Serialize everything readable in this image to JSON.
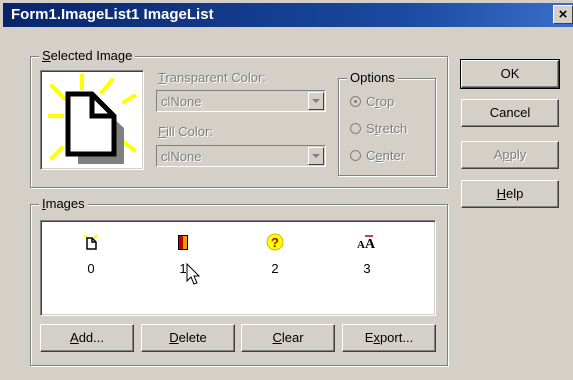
{
  "window": {
    "title": "Form1.ImageList1 ImageList",
    "close_glyph": "×"
  },
  "selected_image": {
    "group_label_pre": "",
    "group_label_u": "S",
    "group_label_post": "elected Image",
    "transparent_color": {
      "label_u": "T",
      "label_post": "ransparent Color:",
      "value": "clNone"
    },
    "fill_color": {
      "label_u": "F",
      "label_post": "ill Color:",
      "value": "clNone"
    },
    "options": {
      "label": "Options",
      "crop": {
        "u": "r",
        "pre": "C",
        "post": "op",
        "selected": true
      },
      "stretch": {
        "pre": "S",
        "u": "t",
        "post": "retch"
      },
      "center": {
        "pre": "C",
        "u": "e",
        "post": "nter"
      }
    }
  },
  "images": {
    "group_label_u": "I",
    "group_label_post": "mages",
    "items": [
      {
        "caption": "0",
        "icon": "new-document-icon"
      },
      {
        "caption": "1",
        "icon": "door-icon"
      },
      {
        "caption": "2",
        "icon": "help-icon"
      },
      {
        "caption": "3",
        "icon": "font-icon"
      }
    ]
  },
  "buttons": {
    "ok": "OK",
    "cancel": "Cancel",
    "apply_pre": "A",
    "apply_u": "p",
    "apply_post": "ply",
    "help_u": "H",
    "help_post": "elp",
    "add_u": "A",
    "add_post": "dd...",
    "delete_u": "D",
    "delete_post": "elete",
    "clear_u": "C",
    "clear_post": "lear",
    "export_pre": "E",
    "export_u": "x",
    "export_post": "port..."
  },
  "colors": {
    "face": "#d4d0c8",
    "title": "#0a246a",
    "highlight": "#ffff00"
  }
}
